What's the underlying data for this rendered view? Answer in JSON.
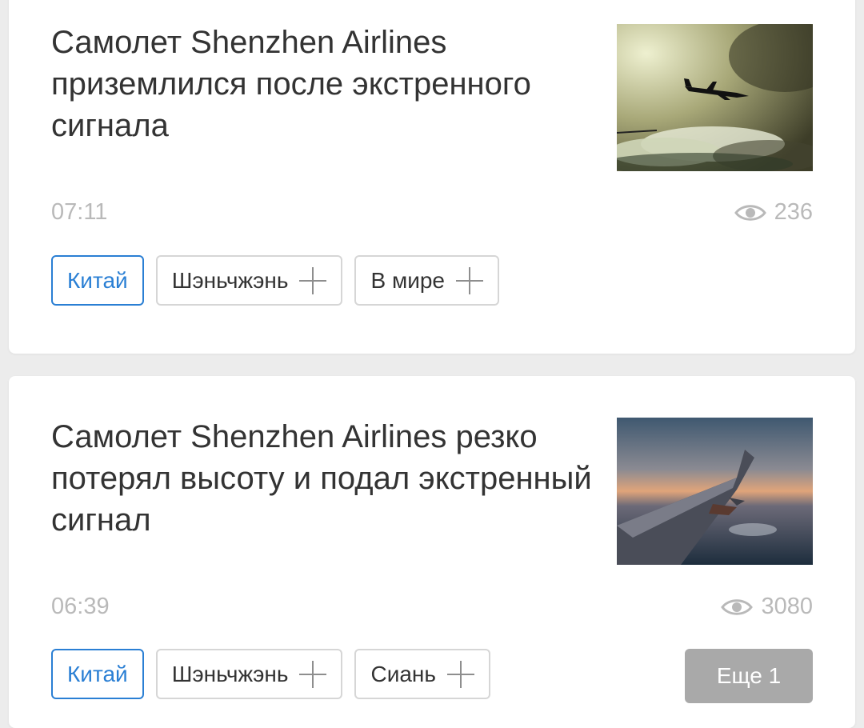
{
  "articles": [
    {
      "title": "Самолет Shenzhen Airlines приземлился после экстренного сигнала",
      "time": "07:11",
      "views": "236",
      "tags": [
        {
          "label": "Китай",
          "active": true
        },
        {
          "label": "Шэньчжэнь",
          "active": false
        },
        {
          "label": "В мире",
          "active": false
        }
      ]
    },
    {
      "title": "Самолет Shenzhen Airlines резко потерял высоту и подал экстренный сигнал",
      "time": "06:39",
      "views": "3080",
      "tags": [
        {
          "label": "Китай",
          "active": true
        },
        {
          "label": "Шэньчжэнь",
          "active": false
        },
        {
          "label": "Сиань",
          "active": false
        }
      ],
      "more_label": "Еще 1"
    }
  ],
  "icons": {
    "views": "eye-icon",
    "add_tag": "plus-icon"
  },
  "colors": {
    "accent": "#2a7fd4",
    "muted": "#b9b9b9",
    "more_bg": "#a9a9a9"
  }
}
